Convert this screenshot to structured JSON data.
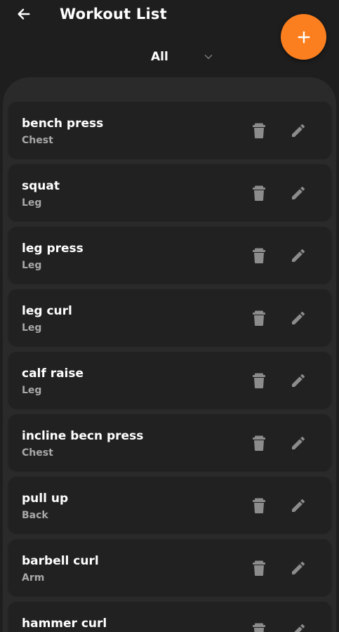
{
  "header": {
    "title": "Workout List",
    "back_icon": "arrow-left-icon",
    "add_icon": "plus-icon"
  },
  "filter": {
    "selected": "All",
    "icon": "chevron-down-icon"
  },
  "colors": {
    "background": "#1e1e1f",
    "panel": "#2a2a2b",
    "card": "#212122",
    "accent": "#fb7f1f",
    "icon": "#8c8c8c",
    "secondary_text": "#a8a8a8"
  },
  "workouts": [
    {
      "name": "bench press",
      "category": "Chest"
    },
    {
      "name": "squat",
      "category": "Leg"
    },
    {
      "name": "leg press",
      "category": "Leg"
    },
    {
      "name": "leg curl",
      "category": "Leg"
    },
    {
      "name": "calf raise",
      "category": "Leg"
    },
    {
      "name": "incline becn press",
      "category": "Chest"
    },
    {
      "name": "pull up",
      "category": "Back"
    },
    {
      "name": "barbell curl",
      "category": "Arm"
    },
    {
      "name": "hammer curl",
      "category": ""
    }
  ],
  "row_icons": {
    "delete": "trash-icon",
    "edit": "pencil-icon"
  }
}
